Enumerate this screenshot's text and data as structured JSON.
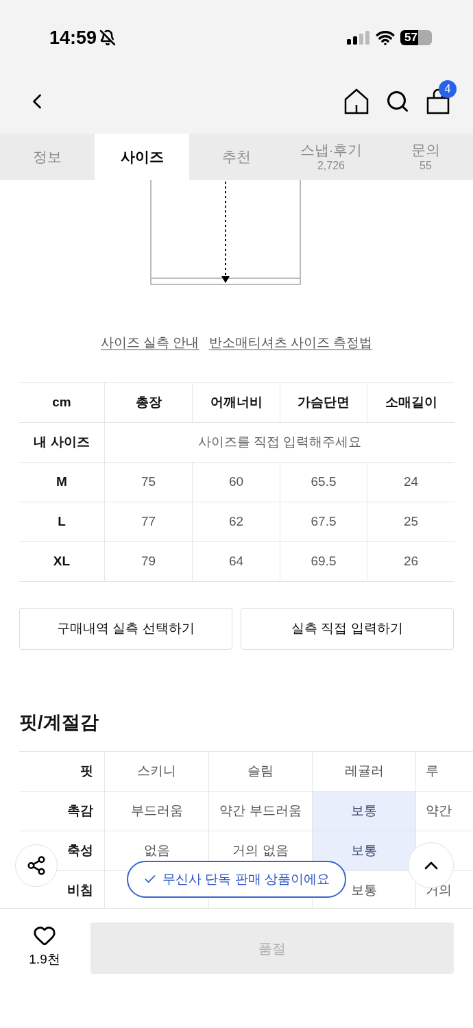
{
  "status_bar": {
    "time": "14:59",
    "battery": "57"
  },
  "nav": {
    "cart_count": "4"
  },
  "tabs": [
    {
      "label": "정보",
      "selected": false
    },
    {
      "label": "사이즈",
      "selected": true
    },
    {
      "label": "추천",
      "selected": false
    },
    {
      "label": "스냅·후기",
      "count": "2,726",
      "selected": false
    },
    {
      "label": "문의",
      "count": "55",
      "selected": false
    }
  ],
  "links": [
    "사이즈 실측 안내",
    "반소매티셔츠 사이즈 측정법"
  ],
  "size_table": {
    "columns": [
      "cm",
      "총장",
      "어깨너비",
      "가슴단면",
      "소매길이"
    ],
    "my_size": {
      "label": "내 사이즈",
      "placeholder": "사이즈를 직접 입력해주세요"
    },
    "rows": [
      {
        "size": "M",
        "values": [
          "75",
          "60",
          "65.5",
          "24"
        ]
      },
      {
        "size": "L",
        "values": [
          "77",
          "62",
          "67.5",
          "25"
        ]
      },
      {
        "size": "XL",
        "values": [
          "79",
          "64",
          "69.5",
          "26"
        ]
      }
    ]
  },
  "buttons": [
    "구매내역 실측 선택하기",
    "실측 직접 입력하기"
  ],
  "fit_section": {
    "title": "핏/계절감",
    "rows": [
      {
        "label": "핏",
        "cells": [
          {
            "text": "스키니",
            "selected": false
          },
          {
            "text": "슬림",
            "selected": false
          },
          {
            "text": "레귤러",
            "selected": false
          },
          {
            "text": "루",
            "selected": false
          }
        ]
      },
      {
        "label": "촉감",
        "cells": [
          {
            "text": "부드러움",
            "selected": false
          },
          {
            "text": "약간 부드러움",
            "selected": false
          },
          {
            "text": "보통",
            "selected": true
          },
          {
            "text": "약간",
            "selected": false
          }
        ]
      },
      {
        "label": "축성",
        "cells": [
          {
            "text": "없음",
            "selected": false
          },
          {
            "text": "거의 없음",
            "selected": false
          },
          {
            "text": "보통",
            "selected": true
          },
          {
            "text": ""
          }
        ]
      },
      {
        "label": "비침",
        "cells": [
          {
            "text": ""
          },
          {
            "text": ""
          },
          {
            "text": "보통",
            "selected": false
          },
          {
            "text": "거의",
            "selected": false
          }
        ]
      }
    ]
  },
  "exclusive_badge": "무신사 단독 판매 상품이에요",
  "bottom_bar": {
    "like_count": "1.9천",
    "buy_button": {
      "label": "품절",
      "disabled": true
    }
  }
}
